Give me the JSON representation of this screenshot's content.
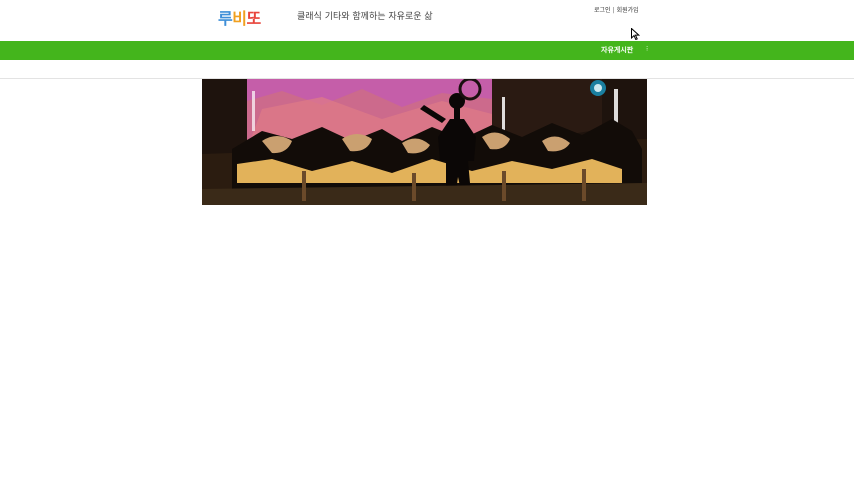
{
  "header": {
    "logo": {
      "chars": [
        "루",
        "비",
        "또"
      ],
      "colors": [
        "#3f8fd8",
        "#f0a020",
        "#e8453c"
      ]
    },
    "tagline": "클래식 기타와 함께하는 자유로운 삶",
    "util_links": {
      "login": "로그인",
      "separator": "|",
      "signup": "회원가입"
    }
  },
  "nav": {
    "items": [
      {
        "label": "자유게시판"
      }
    ],
    "more_label": "⁝",
    "color": "#44b51c"
  },
  "banner": {
    "description_icon": "orchestra-silhouette-image"
  }
}
